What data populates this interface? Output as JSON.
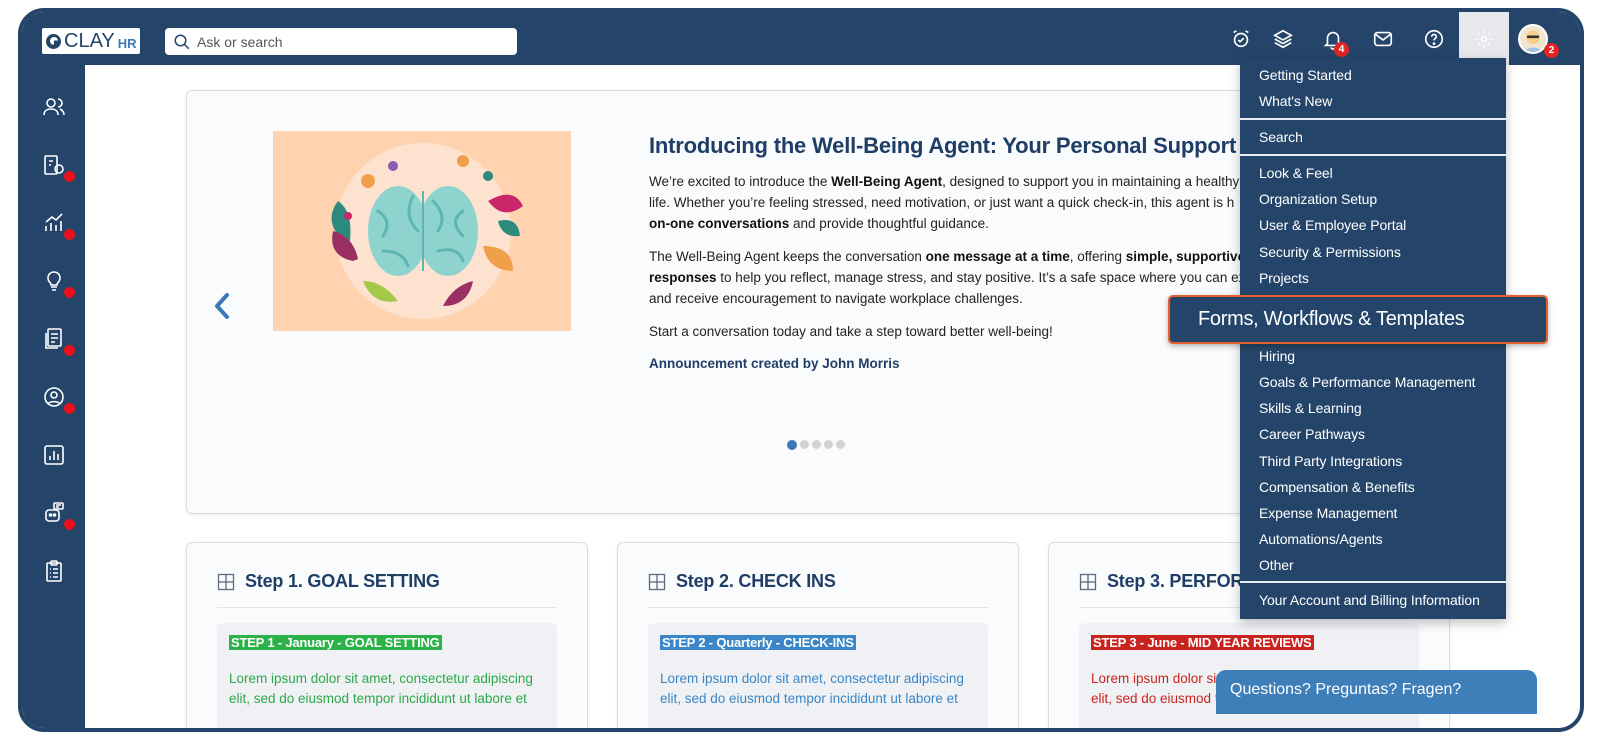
{
  "header": {
    "logo_text": "CLAY",
    "logo_suffix": "HR",
    "search_placeholder": "Ask or search",
    "notifications_count": "4",
    "avatar_count": "2"
  },
  "hero": {
    "title": "Introducing the Well-Being Agent: Your Personal Support Con",
    "p1_pre": "We’re excited to introduce the ",
    "p1_bold1": "Well-Being Agent",
    "p1_mid": ", designed to support you in maintaining a healthy\nlife. Whether you’re feeling stressed, need motivation, or just want a quick check-in, this agent is h\n",
    "p1_bold2": "on-one conversations",
    "p1_post": " and provide thoughtful guidance.",
    "p2_pre": "The Well-Being Agent keeps the conversation ",
    "p2_bold1": "one message at a time",
    "p2_mid": ", offering ",
    "p2_bold2": "simple, supportive, a",
    "p2_nl": "\n",
    "p2_bold3": "responses",
    "p2_post": " to help you reflect, manage stress, and stay positive. It’s a safe space where you can exp\nand receive encouragement to navigate workplace challenges.",
    "p3": "Start a conversation today and take a step toward better well-being!",
    "author": "Announcement created by John Morris",
    "active_slide": 1,
    "slide_count": 5
  },
  "steps": [
    {
      "title": "Step 1. GOAL SETTING",
      "tag": "STEP 1 - January - GOAL SETTING",
      "tag_bg": "#2db24a",
      "tag_color": "#ffffff",
      "desc": "Lorem ipsum dolor sit amet, consectetur adipiscing elit, sed do eiusmod tempor incididunt ut labore et",
      "desc_color": "#2da84a"
    },
    {
      "title": "Step 2. CHECK INS",
      "tag": "STEP 2 - Quarterly -  CHECK-INS",
      "tag_bg": "#3b86c6",
      "tag_color": "#ffffff",
      "desc": "Lorem ipsum dolor sit amet, consectetur adipiscing elit, sed do eiusmod tempor incididunt ut labore et",
      "desc_color": "#3b86c6"
    },
    {
      "title": "Step 3. PERFOR",
      "tag": "STEP 3 - June - MID YEAR REVIEWS",
      "tag_bg": "#c9231f",
      "tag_color": "#ffffff",
      "desc": "Lorem ipsum dolor sit amet, consectetur adipiscing elit, sed do eiusmod t",
      "desc_color": "#c9231f"
    }
  ],
  "menu": {
    "items": [
      "Getting Started",
      "What's New",
      "Search",
      "Look & Feel",
      "Organization Setup",
      "User & Employee Portal",
      "Security & Permissions",
      "Projects",
      "Forms, Workflows & Templates",
      "Hiring",
      "Goals & Performance Management",
      "Skills & Learning",
      "Career Pathways",
      "Third Party Integrations",
      "Compensation & Benefits",
      "Expense Management",
      "Automations/Agents",
      "Other",
      "Your Account and Billing Information"
    ]
  },
  "chat": {
    "label": "Questions? Preguntas? Fragen?"
  },
  "colors": {
    "navy": "#244569",
    "accent_blue": "#3b78b8",
    "highlight_border": "#e4602c",
    "badge_red": "#e02424"
  }
}
